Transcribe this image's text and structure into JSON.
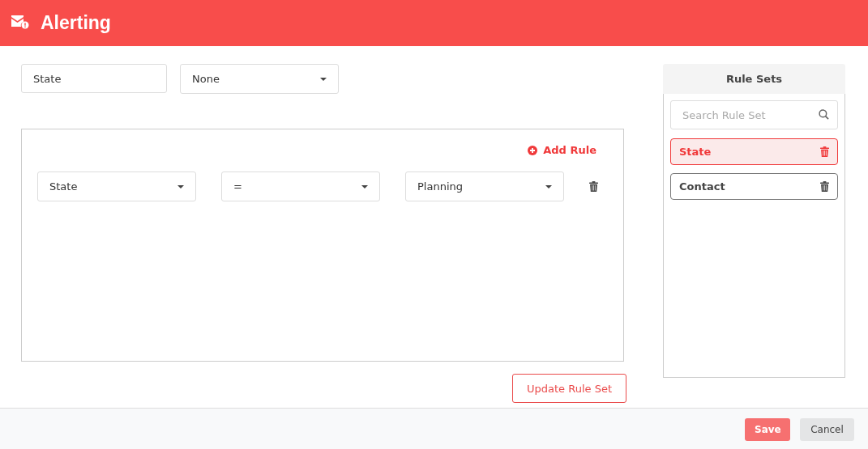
{
  "header": {
    "title": "Alerting"
  },
  "form": {
    "name_field": {
      "value": "State"
    },
    "type_dropdown": {
      "value": "None"
    }
  },
  "rules": {
    "add_label": "Add Rule",
    "items": [
      {
        "field": "State",
        "operator": "=",
        "value": "Planning"
      }
    ]
  },
  "update_button": "Update Rule Set",
  "rule_sets": {
    "title": "Rule Sets",
    "search": {
      "placeholder": "Search Rule Set"
    },
    "items": [
      {
        "label": "State",
        "selected": true
      },
      {
        "label": "Contact",
        "selected": false
      }
    ]
  },
  "footer": {
    "buttons": [
      {
        "label": "Save",
        "kind": "primary"
      },
      {
        "label": "Cancel",
        "kind": "secondary"
      }
    ]
  }
}
